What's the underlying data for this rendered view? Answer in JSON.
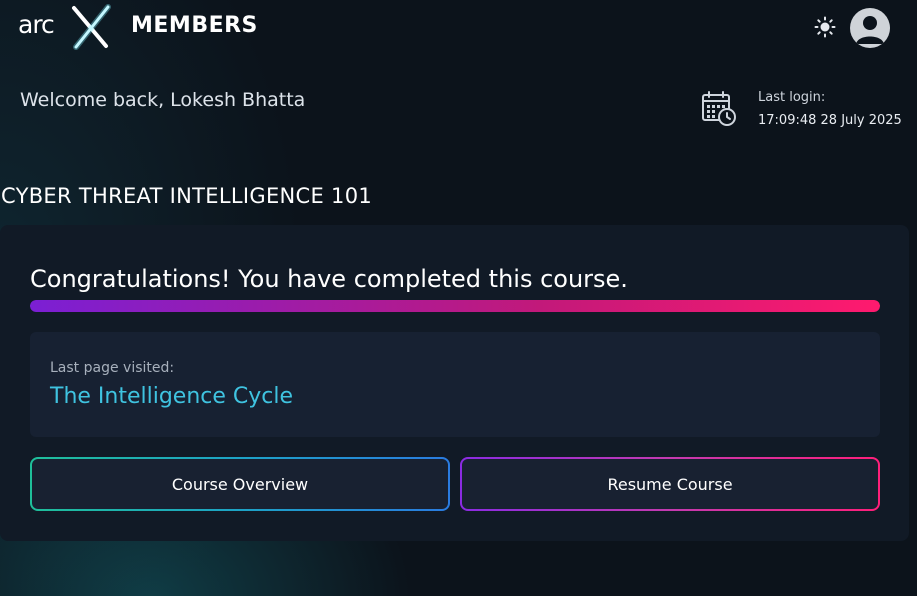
{
  "header": {
    "logo_text": "arcX",
    "section_title": "MEMBERS",
    "theme_icon": "sun-icon",
    "avatar_icon": "user-avatar-icon"
  },
  "welcome": {
    "text": "Welcome back, Lokesh Bhatta"
  },
  "last_login": {
    "icon": "calendar-clock-icon",
    "label": "Last login:",
    "value": "17:09:48 28 July 2025"
  },
  "course": {
    "title": "CYBER THREAT INTELLIGENCE 101",
    "completion_message": "Congratulations! You have completed this course.",
    "progress_percent": 100,
    "last_page_label": "Last page visited:",
    "last_page_title": "The Intelligence Cycle",
    "overview_button": "Course Overview",
    "resume_button": "Resume Course"
  },
  "colors": {
    "background": "#0c131b",
    "card": "#111a26",
    "accent_link": "#3fc3e0",
    "progress_start": "#7b1fd4",
    "progress_end": "#ff1a6e"
  }
}
